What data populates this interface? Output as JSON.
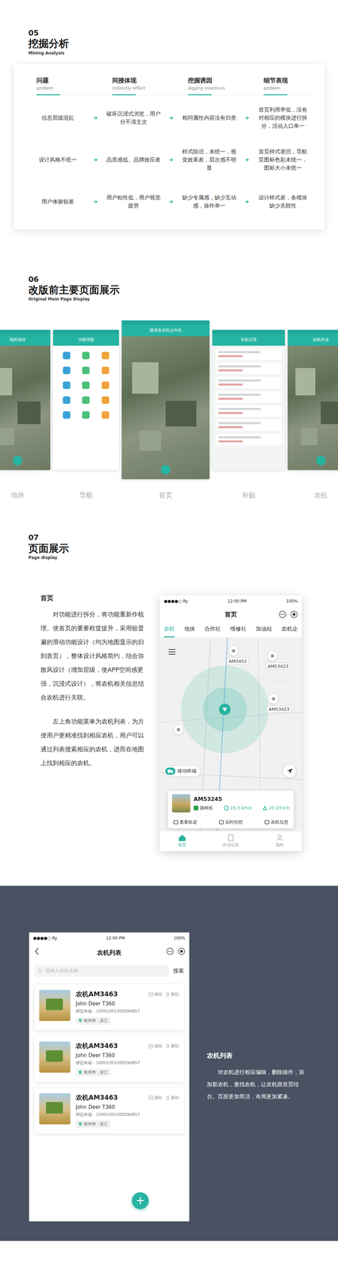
{
  "analysis": {
    "number": "05",
    "title": "挖掘分析",
    "subtitle": "Mining Analysis",
    "columns": [
      {
        "title": "问题",
        "sub": "problem"
      },
      {
        "title": "间接体现",
        "sub": "indirectly  reflect"
      },
      {
        "title": "挖掘诱因",
        "sub": "digging  incentives"
      },
      {
        "title": "细节表现",
        "sub": "problem"
      }
    ],
    "rows": [
      [
        "信息层级混乱",
        "破坏沉浸式浏览，用户分不清主次",
        "相同属性内容没有归类",
        "首页利用率低，没有对相应的模块进行拆分，活动入口单一"
      ],
      [
        "设计风格不统一",
        "品质感低、品牌效应差",
        "样式陈旧，未统一，视觉效果差，层次感不明显",
        "首页样式老旧，导航页图标色彩未统一，图标大小未统一"
      ],
      [
        "用户体验较差",
        "用户粘性低，用户视觉疲劳",
        "缺少专属感，缺少互动感，操作单一",
        "设计样式差，各模块缺少关联性"
      ]
    ]
  },
  "original": {
    "number": "06",
    "title": "改版前主要页面展示",
    "subtitle": "Original Main Page  Display",
    "screens": [
      {
        "label": "地块",
        "title": "我的地块",
        "kind": "map"
      },
      {
        "label": "导航",
        "title": "功能导航",
        "kind": "grid"
      },
      {
        "label": "首页",
        "title": "德清县农机合作社",
        "kind": "map"
      },
      {
        "label": "补贴",
        "title": "补贴记录",
        "kind": "list"
      },
      {
        "label": "农机",
        "title": "农机作业",
        "kind": "map"
      }
    ]
  },
  "display": {
    "number": "07",
    "title": "页面展示",
    "subtitle": "Page display"
  },
  "home": {
    "heading": "首页",
    "paragraphs": [
      "对功能进行拆分，将功能重新作梳理。使首页的重要程度提升，采用较普遍的滑动功能设计（均为地图显示的归到首页），整体设计风格简约，结合弥散风设计（增加层级，使APP空间感更强，沉浸式设计），将农机相关信息结合农机进行关联。",
      "左上角功能菜单为农机列表，为方便用户更精准找到相应农机，用户可以通过列表搜索相应的农机，进而在地图上找到相应的农机。"
    ],
    "phone": {
      "status": {
        "signal": "●●●●○",
        "carrier": "Ry",
        "time": "12:00 PM",
        "battery": "100%"
      },
      "title": "首页",
      "tabs": [
        {
          "label": "农机",
          "selected": true
        },
        {
          "label": "地块",
          "selected": false
        },
        {
          "label": "合作社",
          "selected": false
        },
        {
          "label": "维修社",
          "selected": false
        },
        {
          "label": "加油站",
          "selected": false
        },
        {
          "label": "农机企",
          "selected": false
        }
      ],
      "markers": [
        {
          "label": "AM3452"
        },
        {
          "label": "AM53423"
        },
        {
          "label": "AM53423"
        },
        {
          "label": ""
        }
      ],
      "terminal_button": "移动终端",
      "card": {
        "id": "AM53245",
        "type": "插秧机",
        "speed": "10.3 km/s",
        "distance": "20.23 km",
        "actions": [
          "查看轨迹",
          "实时拍照",
          "农机信息"
        ]
      },
      "nav": [
        {
          "label": "首页",
          "selected": true
        },
        {
          "label": "作业记录",
          "selected": false
        },
        {
          "label": "我的",
          "selected": false
        }
      ]
    }
  },
  "list": {
    "heading": "农机列表",
    "paragraph": "对农机进行相应编辑，删除操作，添加新农机，查找农机，让农机跟首页结合。页面更加简洁，布局更加紧凑。",
    "phone": {
      "status": {
        "signal": "●●●●○",
        "carrier": "Ry",
        "time": "12:00 PM",
        "battery": "100%"
      },
      "title": "农机列表",
      "search": {
        "placeholder": "请输入农机名称",
        "button": "搜索"
      },
      "items": [
        {
          "name": "农机AM3463",
          "model": "John Deer T360",
          "terminal": "绑定终端：10001001000294857",
          "city": "杭州市",
          "district": "滨江",
          "edit": "编辑",
          "delete": "删除"
        },
        {
          "name": "农机AM3463",
          "model": "John Deer T360",
          "terminal": "绑定终端：10001001000294857",
          "city": "杭州市",
          "district": "滨江",
          "edit": "编辑",
          "delete": "删除"
        },
        {
          "name": "农机AM3463",
          "model": "John Deer T360",
          "terminal": "绑定终端：10001001000294857",
          "city": "杭州市",
          "district": "滨江",
          "edit": "编辑",
          "delete": "删除"
        }
      ],
      "fab": "+"
    }
  }
}
